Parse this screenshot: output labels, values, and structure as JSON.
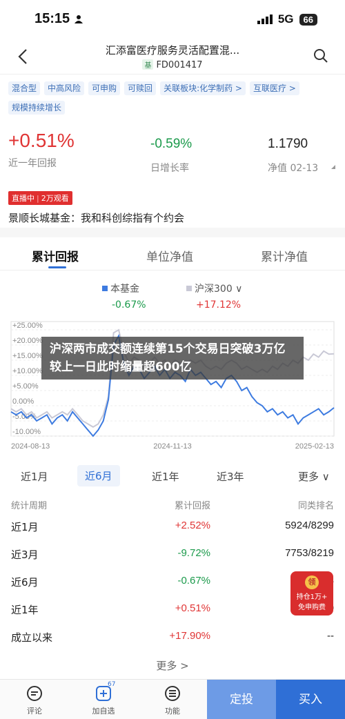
{
  "status": {
    "time": "15:15",
    "network": "5G",
    "battery": "66"
  },
  "nav": {
    "title": "汇添富医疗服务灵活配置混...",
    "code_mark": "基",
    "code": "FD001417"
  },
  "tags": [
    "混合型",
    "中高风险",
    "可申购",
    "可赎回",
    "关联板块:化学制药 >",
    "互联医疗 >",
    "规模持续增长"
  ],
  "metrics": {
    "yearly": {
      "value": "+0.51%",
      "label": "近一年回报"
    },
    "daily": {
      "value": "-0.59%",
      "label": "日增长率"
    },
    "nav": {
      "value": "1.1790",
      "label": "净值 02-13"
    }
  },
  "live": {
    "badge_a": "直播中",
    "badge_b": "2万观看",
    "text": "景顺长城基金：我和科创综指有个约会"
  },
  "tabs": [
    "累计回报",
    "单位净值",
    "累计净值"
  ],
  "legend": [
    {
      "name": "本基金",
      "value": "-0.67%",
      "color": "#3d7be0"
    },
    {
      "name": "沪深300 ∨",
      "value": "+17.12%",
      "color": "#c9c9d6"
    }
  ],
  "banner": "沪深两市成交额连续第15个交易日突破3万亿 较上一日此时缩量超600亿",
  "chart_data": {
    "type": "line",
    "y_ticks": [
      "+25.00%",
      "+20.00%",
      "+15.00%",
      "+10.00%",
      "+5.00%",
      "0.00%",
      "-5.00%",
      "-10.00%"
    ],
    "x_ticks": [
      "2024-08-13",
      "2024-11-13",
      "2025-02-13"
    ],
    "ylim": [
      -10,
      25
    ],
    "series": [
      {
        "name": "本基金",
        "color": "#3d7be0",
        "values": [
          -2,
          -3,
          -2,
          -4,
          -3,
          -5,
          -4,
          -3,
          -6,
          -4,
          -3,
          -5,
          -2,
          -4,
          -6,
          -8,
          -10,
          -8,
          -5,
          2,
          20,
          23,
          14,
          10,
          13,
          12,
          9,
          11,
          13,
          10,
          12,
          9,
          11,
          10,
          8,
          12,
          10,
          11,
          9,
          7,
          8,
          6,
          9,
          10,
          8,
          5,
          6,
          3,
          1,
          0,
          -2,
          -1,
          -3,
          -2,
          -4,
          -3,
          -6,
          -4,
          -3,
          -2,
          -1,
          -3,
          -2,
          -0.67
        ]
      },
      {
        "name": "沪深300",
        "color": "#c9c9d6",
        "values": [
          -1,
          -2,
          -1,
          -3,
          -2,
          -4,
          -3,
          -2,
          -4,
          -3,
          -2,
          -3,
          -1,
          -3,
          -5,
          -6,
          -7,
          -6,
          -3,
          3,
          24,
          25,
          18,
          14,
          16,
          15,
          13,
          14,
          16,
          14,
          15,
          13,
          15,
          14,
          12,
          15,
          14,
          15,
          13,
          12,
          13,
          12,
          14,
          15,
          14,
          12,
          13,
          12,
          11,
          12,
          11,
          13,
          12,
          14,
          13,
          15,
          14,
          16,
          15,
          17,
          16,
          18,
          17,
          17.12
        ]
      }
    ]
  },
  "ranges": [
    "近1月",
    "近6月",
    "近1年",
    "近3年",
    "更多 ∨"
  ],
  "table": {
    "headers": [
      "统计周期",
      "累计回报",
      "同类排名"
    ],
    "rows": [
      {
        "period": "近1月",
        "ret": "+2.52%",
        "rank": "5924/8299",
        "dir": "up"
      },
      {
        "period": "近3月",
        "ret": "-9.72%",
        "rank": "7753/8219",
        "dir": "down"
      },
      {
        "period": "近6月",
        "ret": "-0.67%",
        "rank": "78",
        "dir": "down"
      },
      {
        "period": "近1年",
        "ret": "+0.51%",
        "rank": "70",
        "dir": "up"
      },
      {
        "period": "成立以来",
        "ret": "+17.90%",
        "rank": "--",
        "dir": "up"
      }
    ],
    "more": "更多 >"
  },
  "redpacket": {
    "coin": "领",
    "line1": "持仓1万+",
    "line2": "免申购费"
  },
  "bottom": {
    "comment": "评论",
    "watch": "加自选",
    "watch_count": "67",
    "features": "功能",
    "fixed": "定投",
    "buy": "买入"
  }
}
